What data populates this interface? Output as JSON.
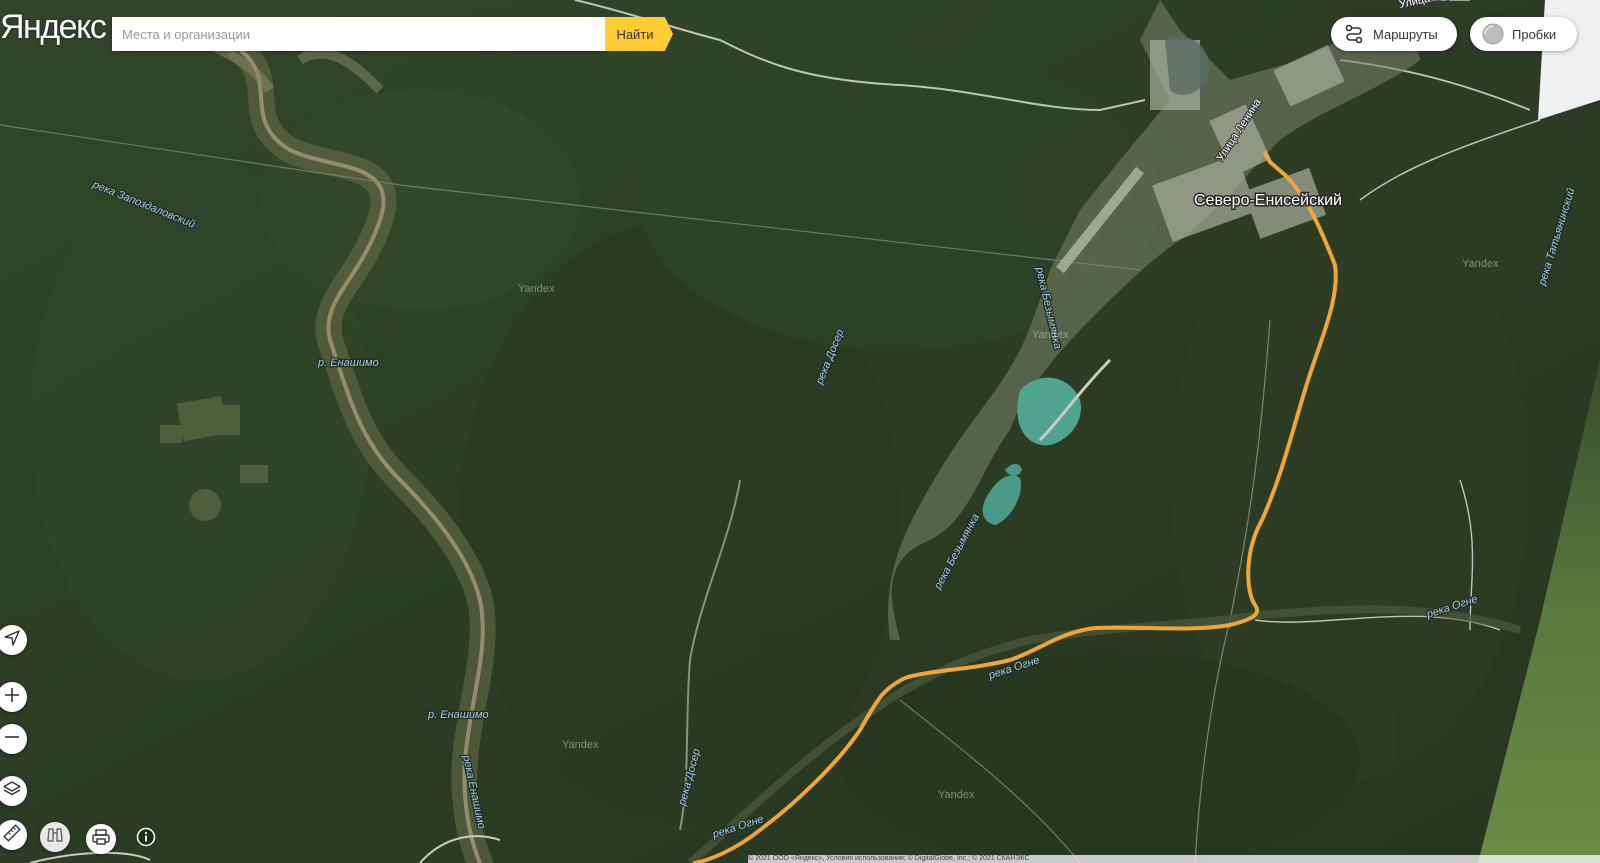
{
  "brand": {
    "logo_text": "Яндекс"
  },
  "search": {
    "placeholder": "Места и организации",
    "button_label": "Найти"
  },
  "top_buttons": {
    "routes_label": "Маршруты",
    "traffic_label": "Пробки"
  },
  "map_labels": {
    "town": "Северо-Енисейский",
    "street_lenina": "Улица Ленина",
    "street_marksa": "Улица Карла Маркса",
    "river_zapozdalovsky": "река Запоздаловский",
    "river_enashimo_1": "р. Енашимо",
    "river_enashimo_2": "р. Енашимо",
    "river_enashimo_3": "река Енашимо",
    "river_doser_1": "река Досер",
    "river_doser_2": "река Досер",
    "river_bezymyanka_1": "река Безымянка",
    "river_bezymyanka_2": "река Безымянка",
    "river_tatyaninsky": "река Татьянинский",
    "river_ogne_1": "река Огне",
    "river_ogne_2": "река Огне",
    "river_ogne_3": "река Огне",
    "watermark": "Yandex"
  },
  "footer": {
    "copyright": "© 2021 ООО «Яндекс», Условия использования; © DigitalGlobe, Inc.; © 2021 СКАНЭКС"
  },
  "colors": {
    "route": "#f0a53a",
    "search_button": "#ffcc33",
    "forest": "#2e3f25",
    "water": "#4fa38f"
  },
  "icons": {
    "routes": "route-icon",
    "traffic": "traffic-icon",
    "geolocation": "navigation-arrow-icon",
    "zoom_in": "plus-icon",
    "zoom_out": "minus-icon",
    "layers": "layers-icon",
    "ruler": "ruler-icon",
    "panorama": "binoculars-icon",
    "print": "printer-icon",
    "info": "info-icon"
  }
}
